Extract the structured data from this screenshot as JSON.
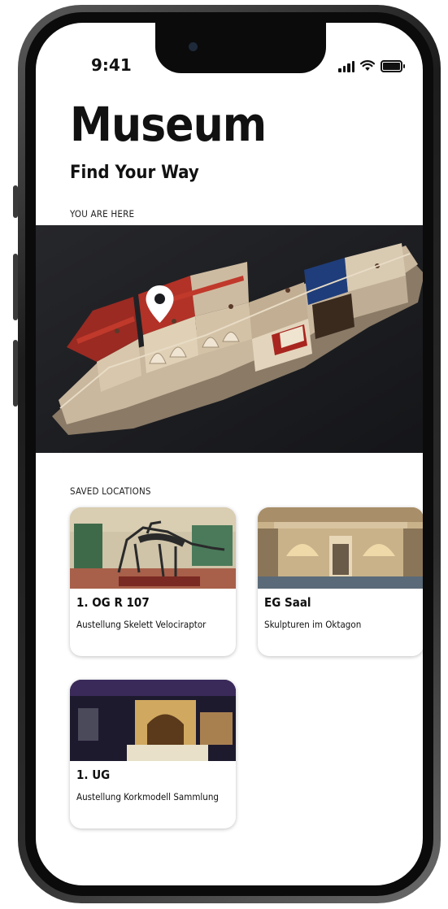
{
  "status_bar": {
    "time": "9:41"
  },
  "header": {
    "title": "Museum",
    "subtitle": "Find Your Way"
  },
  "current_location": {
    "label": "YOU ARE HERE"
  },
  "saved_locations": {
    "label": "SAVED LOCATIONS",
    "items": [
      {
        "title": "1. OG R 107",
        "description": "Austellung Skelett Velociraptor"
      },
      {
        "title": "EG Saal",
        "description": "Skulpturen im Oktagon"
      },
      {
        "title": "1. UG",
        "description": "Austellung Korkmodell Sammlung"
      }
    ]
  }
}
